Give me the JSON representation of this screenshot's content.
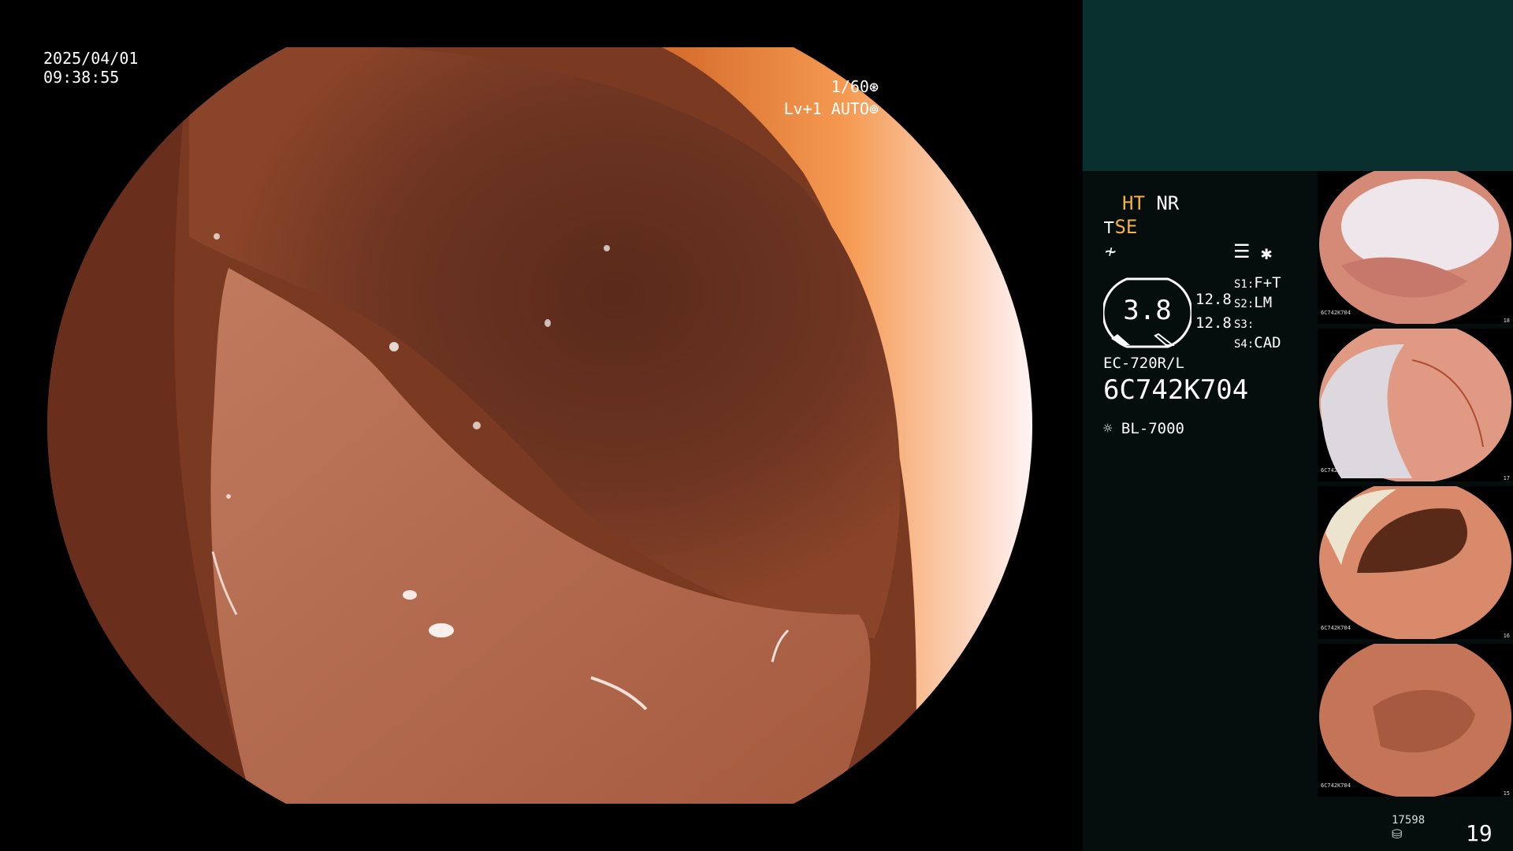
{
  "overlay": {
    "date": "2025/04/01",
    "time": "09:38:55",
    "shutter": "1/60",
    "level": "Lv+1",
    "iris": "AUTO"
  },
  "panel": {
    "ht": "HT",
    "nr": "NR",
    "se": "SE",
    "gauge_value": "3.8",
    "gauge_side_1": "12.8",
    "gauge_side_2": "12.8",
    "s1_label": "S1:",
    "s1_value": "F+T",
    "s2_label": "S2:",
    "s2_value": "LM",
    "s3_label": "S3:",
    "s3_value": "",
    "s4_label": "S4:",
    "s4_value": "CAD",
    "scope_model": "EC-720R/L",
    "serial": "6C742K704",
    "light_source": "BL-7000",
    "image_count": "17598",
    "page_number": "19"
  },
  "thumbnails": [
    {
      "index": 1,
      "serial": "6C742K704",
      "number": "18"
    },
    {
      "index": 2,
      "serial": "6C742K704",
      "number": "17"
    },
    {
      "index": 3,
      "serial": "6C742K704",
      "number": "16"
    },
    {
      "index": 4,
      "serial": "6C742K704",
      "number": "15"
    }
  ],
  "icons": {
    "shutter": "aperture-icon",
    "iris": "iris-icon",
    "se": "scope-tip-icon",
    "f": "structure-enhance-icon",
    "menu": "list-icon",
    "asterisk": "asterisk-icon",
    "light": "light-bulb-icon",
    "storage": "disk-icon"
  },
  "colors": {
    "panel_top": "#0a2f2f",
    "panel": "#060d0d",
    "accent": "#f5b23c"
  }
}
